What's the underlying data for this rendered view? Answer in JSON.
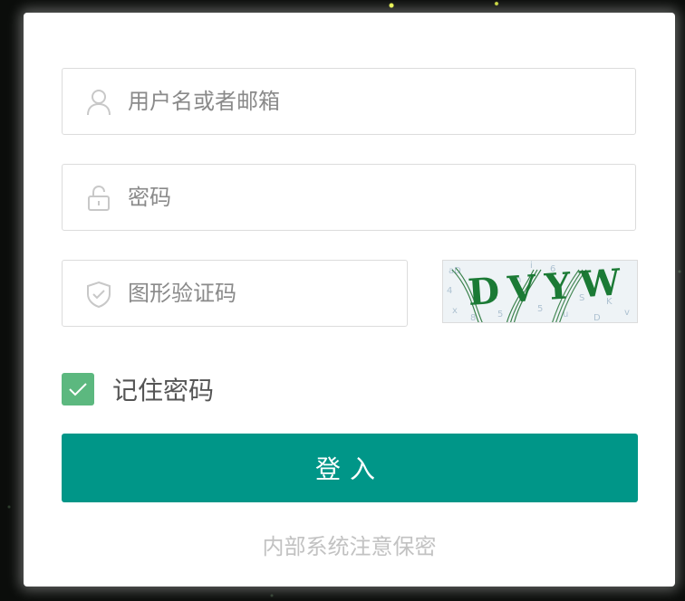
{
  "login": {
    "username_placeholder": "用户名或者邮箱",
    "password_placeholder": "密码",
    "captcha_placeholder": "图形验证码",
    "captcha_text": "DVYW",
    "remember_label": "记住密码",
    "remember_checked": true,
    "submit_label": "登入",
    "footer_note": "内部系统注意保密"
  },
  "colors": {
    "accent": "#009688",
    "checkbox": "#5cb87f",
    "border": "#dcdcdc",
    "placeholder": "#8a8a8a",
    "note": "#c2c2c2"
  },
  "icons": {
    "username": "user-icon",
    "password": "lock-icon",
    "captcha": "shield-check-icon",
    "remember": "checkmark-icon"
  }
}
